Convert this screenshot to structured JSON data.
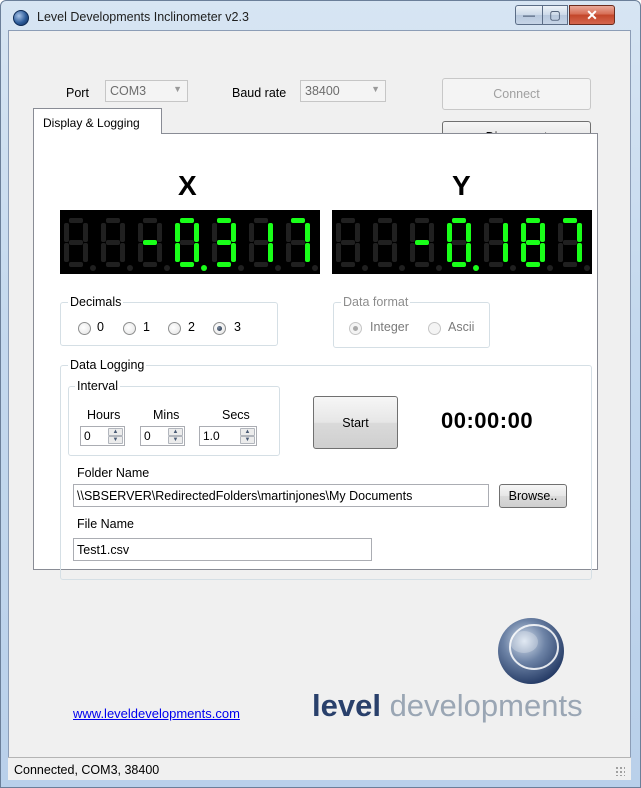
{
  "window": {
    "title": "Level Developments Inclinometer v2.3",
    "controls": {
      "minimize": "—",
      "maximize": "▢",
      "close": "✕"
    }
  },
  "connection": {
    "port_label": "Port",
    "port_value": "COM3",
    "baud_label": "Baud rate",
    "baud_value": "38400",
    "connect_label": "Connect",
    "disconnect_label": "Disconnect"
  },
  "tab": {
    "label": "Display & Logging"
  },
  "displays": {
    "x": {
      "label": "X",
      "value": "-0.317",
      "digits": [
        "",
        "",
        "-",
        "0.",
        "3",
        "1",
        "7"
      ]
    },
    "y": {
      "label": "Y",
      "value": "-0.187",
      "digits": [
        "",
        "",
        "-",
        "0.",
        "1",
        "8",
        "7"
      ]
    },
    "colors": {
      "lit": "#19ff19",
      "unlit": "#202020",
      "background": "#000000"
    }
  },
  "decimals": {
    "title": "Decimals",
    "options": [
      "0",
      "1",
      "2",
      "3"
    ],
    "selected": "3"
  },
  "data_format": {
    "title": "Data format",
    "options": [
      "Integer",
      "Ascii"
    ],
    "selected": "Integer"
  },
  "logging": {
    "title": "Data Logging",
    "interval_title": "Interval",
    "hours_label": "Hours",
    "hours_value": "0",
    "mins_label": "Mins",
    "mins_value": "0",
    "secs_label": "Secs",
    "secs_value": "1.0",
    "start_label": "Start",
    "timer": "00:00:00",
    "folder_label": "Folder Name",
    "folder_value": "\\\\SBSERVER\\RedirectedFolders\\martinjones\\My Documents",
    "browse_label": "Browse..",
    "file_label": "File Name",
    "file_value": "Test1.csv"
  },
  "footer": {
    "link": "www.leveldevelopments.com",
    "logo_bold": "level",
    "logo_light": " developments"
  },
  "status": {
    "text": "Connected, COM3, 38400"
  }
}
